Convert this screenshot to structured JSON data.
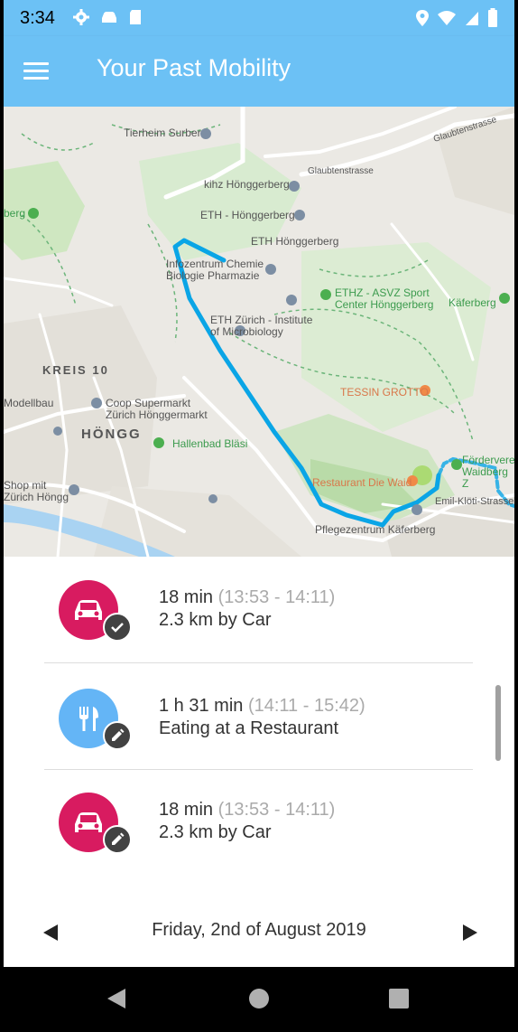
{
  "status_bar": {
    "time": "3:34",
    "left_icons": [
      "gear-icon",
      "car-icon",
      "sd-card-icon"
    ],
    "right_icons": [
      "location-icon",
      "wifi-icon",
      "signal-icon",
      "battery-icon"
    ]
  },
  "app_bar": {
    "title": "Your Past Mobility",
    "menu_icon": "hamburger-menu-icon"
  },
  "map": {
    "labels": {
      "tierheim": "Tierheim Surber",
      "glaubtenstrasse_top": "Glaubtenstrasse",
      "glaubtenstrasse": "Glaubtenstrasse",
      "kihz": "kihz Hönggerberg",
      "eth_hoenggerberg_1": "ETH - Hönggerberg",
      "eth_hoenggerberg_2": "ETH Hönggerberg",
      "berg": "berg",
      "infozentrum": "Infozentrum Chemie Biologie Pharmazie",
      "ethz_asvz": "ETHZ - ASVZ Sport Center Hönggerberg",
      "kaeferberg": "Käferberg",
      "eth_microbiology": "ETH Zürich - Institute of Microbiology",
      "kreis10": "KREIS 10",
      "modellbau": "Modellbau",
      "coop": "Coop Supermarkt Zürich Hönggermarkt",
      "tessin_grotto": "TESSIN GROTTO",
      "hoengg": "HÖNGG",
      "hallenbad": "Hallenbad Bläsi",
      "foerderverein": "Förderverei Waidberg Z",
      "restaurant_waid": "Restaurant Die Waid",
      "shop": "Shop mit Zürich Höngg",
      "emil_kloeti": "Emil-Klöti-Strasse",
      "pflegezentrum": "Pflegezentrum Käferberg"
    }
  },
  "trips": [
    {
      "duration": "18 min",
      "range": "(13:53 - 14:11)",
      "detail": "2.3 km by Car",
      "icon": "car-icon",
      "badge_icon": "check-icon",
      "color": "#d81b60"
    },
    {
      "duration": "1 h 31 min",
      "range": "(14:11 - 15:42)",
      "detail": "Eating at a Restaurant",
      "icon": "restaurant-icon",
      "badge_icon": "edit-pencil-icon",
      "color": "#64b5f6"
    },
    {
      "duration": "18 min",
      "range": "(13:53 - 14:11)",
      "detail": "2.3 km by Car",
      "icon": "car-icon",
      "badge_icon": "edit-pencil-icon",
      "color": "#d81b60"
    }
  ],
  "date_nav": {
    "date": "Friday, 2nd of August 2019",
    "prev_icon": "arrow-left-icon",
    "next_icon": "arrow-right-icon"
  },
  "nav_bar": {
    "back_icon": "back-icon",
    "home_icon": "home-icon",
    "recents_icon": "recents-icon"
  }
}
